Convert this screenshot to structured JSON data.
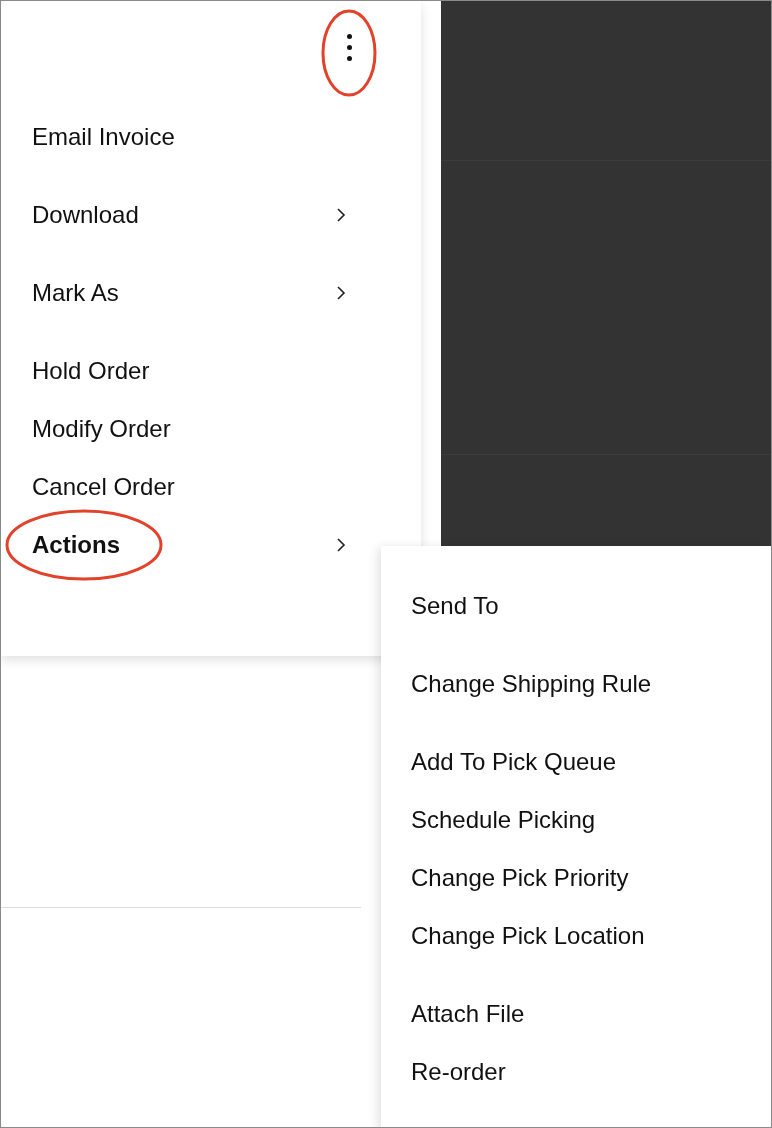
{
  "more_button": {
    "circled": true
  },
  "menu": {
    "groups": [
      [
        {
          "label": "Email Invoice",
          "submenu": false,
          "active": false,
          "circled": false
        }
      ],
      [
        {
          "label": "Download",
          "submenu": true,
          "active": false,
          "circled": false
        }
      ],
      [
        {
          "label": "Mark As",
          "submenu": true,
          "active": false,
          "circled": false
        }
      ],
      [
        {
          "label": "Hold Order",
          "submenu": false,
          "active": false,
          "circled": false
        },
        {
          "label": "Modify Order",
          "submenu": false,
          "active": false,
          "circled": false
        },
        {
          "label": "Cancel Order",
          "submenu": false,
          "active": false,
          "circled": false
        },
        {
          "label": "Actions",
          "submenu": true,
          "active": true,
          "circled": true
        }
      ]
    ]
  },
  "submenu": {
    "groups": [
      [
        {
          "label": "Send To"
        }
      ],
      [
        {
          "label": "Change Shipping Rule"
        }
      ],
      [
        {
          "label": "Add To Pick Queue"
        },
        {
          "label": "Schedule Picking"
        },
        {
          "label": "Change Pick Priority"
        },
        {
          "label": "Change Pick Location"
        }
      ],
      [
        {
          "label": "Attach File"
        },
        {
          "label": "Re-order"
        }
      ]
    ]
  }
}
